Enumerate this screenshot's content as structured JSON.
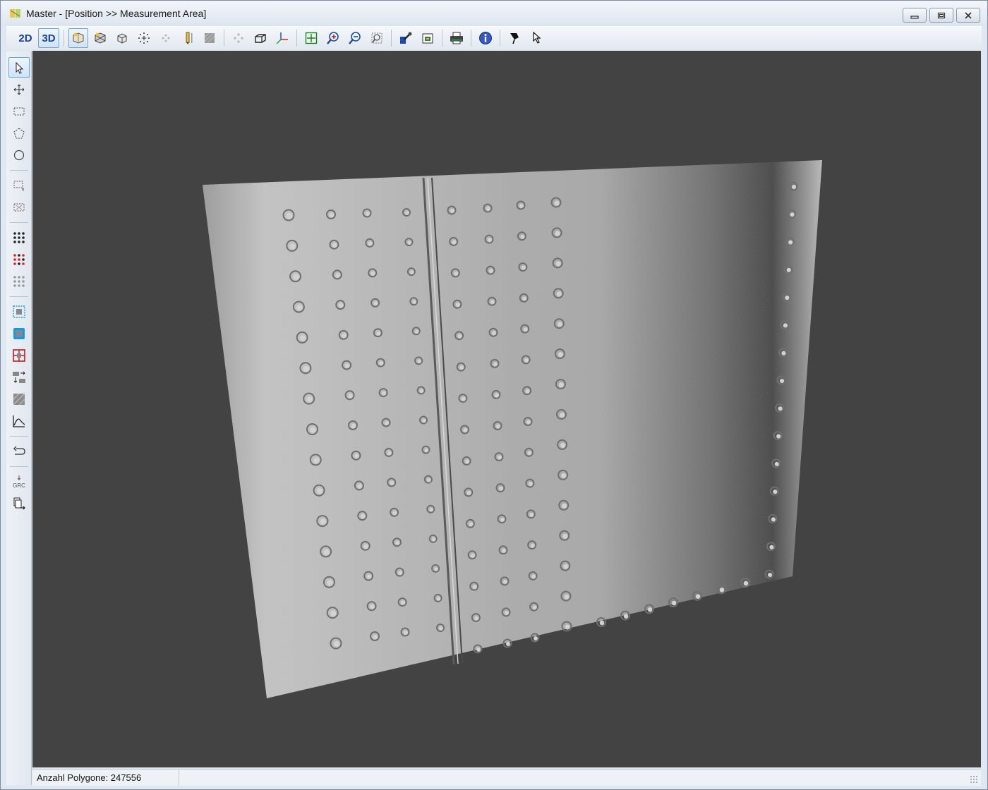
{
  "window": {
    "title": "Master - [Position >> Measurement Area]",
    "controls": [
      "minimize-icon",
      "restore-icon",
      "close-icon"
    ]
  },
  "toolbar": {
    "mode_2d_label": "2D",
    "mode_3d_label": "3D",
    "active_mode": "3D",
    "tools": [
      "shaded-view-icon",
      "textured-view-icon",
      "box-view-icon",
      "point-cloud-icon",
      "points-faded-icon",
      "probe-icon",
      "texture-grey-icon",
      "move-faded-icon",
      "perspective-icon",
      "axes-icon",
      "zoom-fit-icon",
      "zoom-in-icon",
      "zoom-out-icon",
      "zoom-region-icon",
      "settings-icon",
      "snapshot-icon",
      "print-icon",
      "info-icon",
      "marker-icon",
      "pick-icon"
    ]
  },
  "sidebar": {
    "tools": [
      "select-arrow-icon",
      "pan-icon",
      "rect-select-icon",
      "polygon-select-icon",
      "circle-select-icon",
      "rect-deselect-icon",
      "rect-clear-icon",
      "dots-black-icon",
      "dots-red-icon",
      "dots-grey-icon",
      "region-blue-outline-icon",
      "region-blue-fill-icon",
      "crosshair-red-icon",
      "transfer-icon",
      "texture-hatch-icon",
      "profile-curve-icon",
      "undo-icon",
      "grc-icon",
      "export-icon"
    ],
    "grc_label": "GRC"
  },
  "viewport": {
    "background": "#434343",
    "surface_shade": "#b8b8b8",
    "rivet_rows": 15
  },
  "status": {
    "polygon_count_label": "Anzahl Polygone: 247556"
  }
}
